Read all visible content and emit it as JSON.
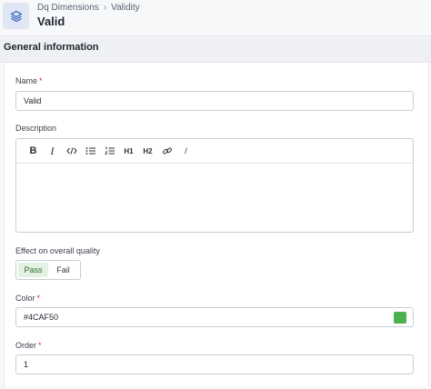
{
  "header": {
    "breadcrumb": {
      "parent": "Dq Dimensions",
      "current": "Validity"
    },
    "title": "Valid",
    "app_icon": "layers-icon"
  },
  "section": {
    "title": "General information"
  },
  "form": {
    "name": {
      "label": "Name",
      "required_mark": "*",
      "value": "Valid"
    },
    "description": {
      "label": "Description",
      "value": "",
      "toolbar": {
        "bold": "B",
        "italic": "I",
        "code": "code-icon",
        "bullet_list": "bullet-list-icon",
        "ordered_list": "ordered-list-icon",
        "h1": "H1",
        "h2": "H2",
        "link": "link-icon",
        "clear": "/"
      }
    },
    "effect": {
      "label": "Effect on overall quality",
      "options": [
        "Pass",
        "Fail"
      ],
      "selected": "Pass"
    },
    "color": {
      "label": "Color",
      "required_mark": "*",
      "value": "#4CAF50",
      "swatch_color": "#4CAF50"
    },
    "order": {
      "label": "Order",
      "required_mark": "*",
      "value": "1"
    }
  },
  "colors": {
    "accent_active_bg": "#e4f2e3",
    "app_icon_bg": "#dfe6f6",
    "app_icon_fg": "#2f5fb8",
    "required": "#d32f2f"
  }
}
